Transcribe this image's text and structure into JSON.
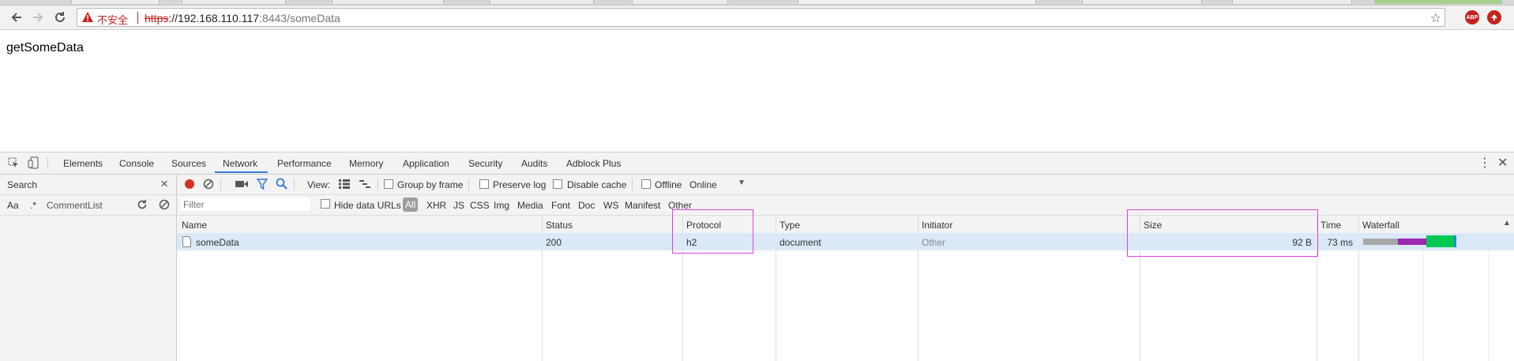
{
  "browser": {
    "security_label": "不安全",
    "url_scheme": "https",
    "url_host": "://192.168.110.117",
    "url_rest": ":8443/someData",
    "extensions": [
      "ABP",
      "uBlock"
    ]
  },
  "page": {
    "body_text": "getSomeData"
  },
  "devtools": {
    "tabs": [
      "Elements",
      "Console",
      "Sources",
      "Network",
      "Performance",
      "Memory",
      "Application",
      "Security",
      "Audits",
      "Adblock Plus"
    ],
    "selected_tab": "Network",
    "search": {
      "label": "Search",
      "match_case": "Aa",
      "regex": ".*",
      "query": "CommentList"
    },
    "network_toolbar": {
      "view_label": "View:",
      "group_by_frame": "Group by frame",
      "preserve_log": "Preserve log",
      "disable_cache": "Disable cache",
      "offline": "Offline",
      "throttling": "Online"
    },
    "filter": {
      "placeholder": "Filter",
      "hide_data_urls": "Hide data URLs",
      "types": [
        "All",
        "XHR",
        "JS",
        "CSS",
        "Img",
        "Media",
        "Font",
        "Doc",
        "WS",
        "Manifest",
        "Other"
      ]
    },
    "table": {
      "columns": [
        "Name",
        "Status",
        "Protocol",
        "Type",
        "Initiator",
        "Size",
        "Time",
        "Waterfall"
      ],
      "rows": [
        {
          "name": "someData",
          "status": "200",
          "protocol": "h2",
          "type": "document",
          "initiator": "Other",
          "size": "92 B",
          "time": "73 ms"
        }
      ]
    },
    "colors": {
      "accent": "#3879d9",
      "highlight": "#e040e0",
      "selected_row": "#dbe8f8"
    }
  }
}
